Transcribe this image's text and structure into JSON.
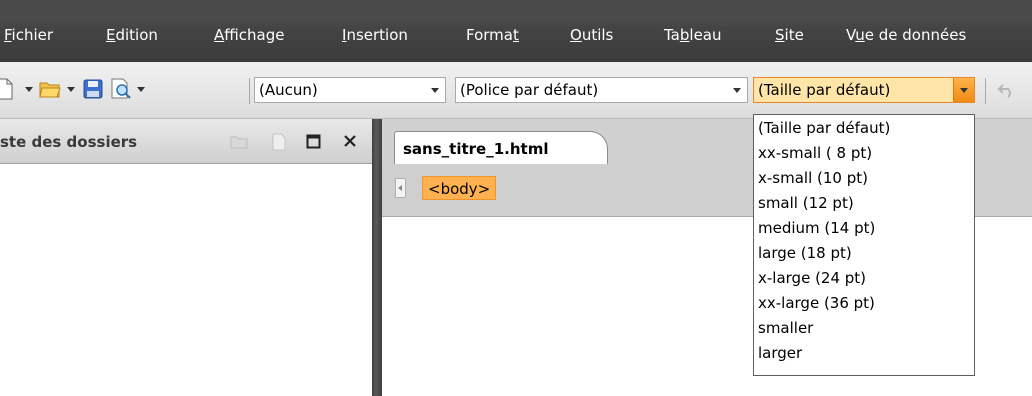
{
  "menu": {
    "items": [
      {
        "id": "fichier",
        "pre": "",
        "u": "F",
        "post": "ichier"
      },
      {
        "id": "edition",
        "pre": "",
        "u": "E",
        "post": "dition"
      },
      {
        "id": "affichage",
        "pre": "",
        "u": "A",
        "post": "ffichage"
      },
      {
        "id": "insertion",
        "pre": "",
        "u": "I",
        "post": "nsertion"
      },
      {
        "id": "format",
        "pre": "Forma",
        "u": "t",
        "post": ""
      },
      {
        "id": "outils",
        "pre": "",
        "u": "O",
        "post": "utils"
      },
      {
        "id": "tableau",
        "pre": "Ta",
        "u": "b",
        "post": "leau"
      },
      {
        "id": "site",
        "pre": "",
        "u": "S",
        "post": "ite"
      },
      {
        "id": "vue",
        "pre": "V",
        "u": "u",
        "post": "e de données"
      }
    ]
  },
  "toolbar": {
    "style_value": "(Aucun)",
    "font_value": "(Police par défaut)",
    "size_value": "(Taille par défaut)"
  },
  "left_panel": {
    "title": "ste des dossiers"
  },
  "document": {
    "tab_label": "sans_titre_1.html",
    "body_tag": "<body>"
  },
  "size_dropdown": {
    "options": [
      {
        "name": "(Taille par défaut)"
      },
      {
        "name": "xx-small ( 8 pt)"
      },
      {
        "name": "x-small  (10 pt)"
      },
      {
        "name": "small    (12 pt)"
      },
      {
        "name": "medium  (14 pt)"
      },
      {
        "name": "large     (18 pt)"
      },
      {
        "name": "x-large  (24 pt)"
      },
      {
        "name": "xx-large (36 pt)"
      },
      {
        "name": "smaller"
      },
      {
        "name": "larger"
      }
    ]
  },
  "colors": {
    "accent_orange": "#f08a12",
    "menubar": "#444444",
    "tag_highlight": "#ffb14f"
  }
}
